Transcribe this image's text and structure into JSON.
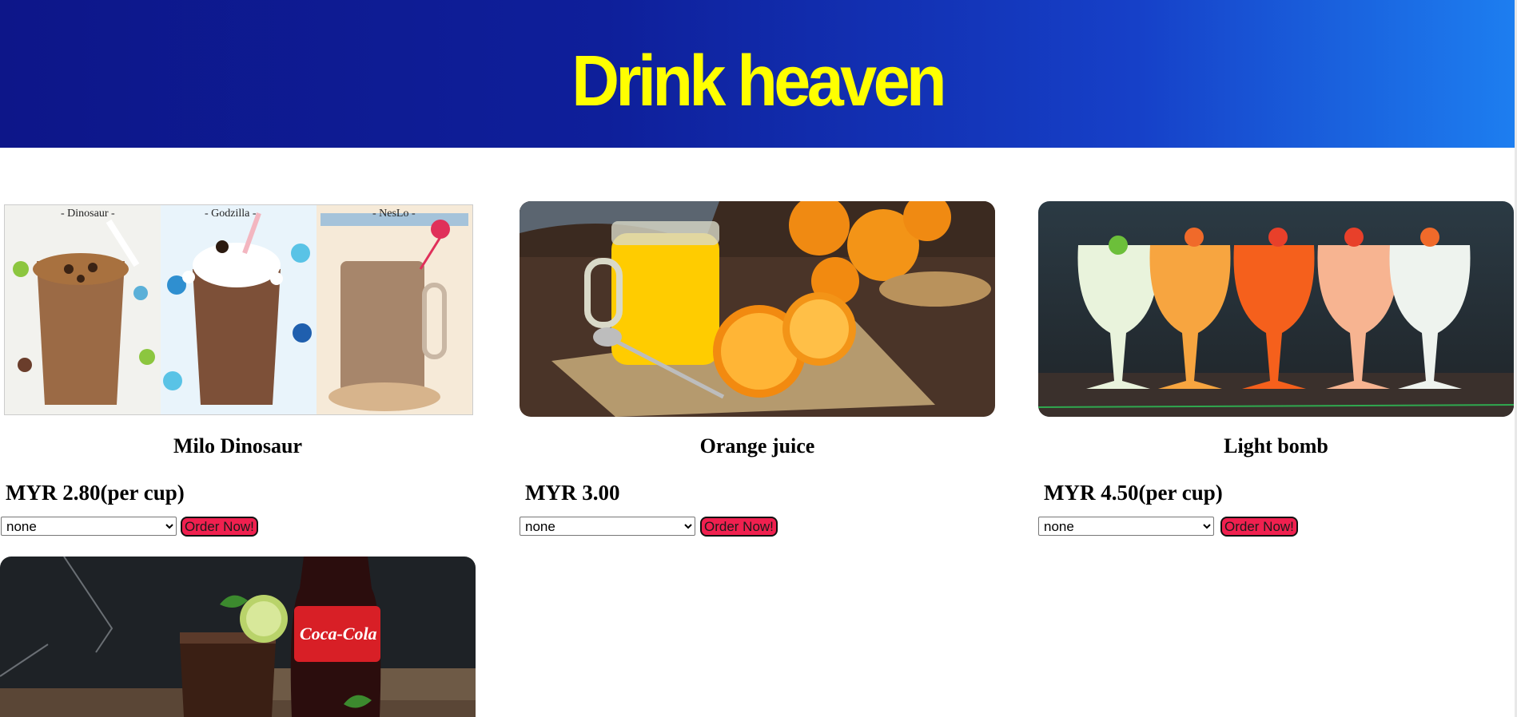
{
  "banner": {
    "title": "Drink heaven"
  },
  "products": [
    {
      "name": "Milo Dinosaur",
      "price": "MYR 2.80(per cup)",
      "select_value": "none",
      "order_label": "Order Now!",
      "image_captions": [
        "- Dinosaur -",
        "- Godzilla -",
        "- NesLo -"
      ]
    },
    {
      "name": "Orange juice",
      "price": "MYR 3.00",
      "select_value": "none",
      "order_label": "Order Now!"
    },
    {
      "name": "Light bomb",
      "price": "MYR 4.50(per cup)",
      "select_value": "none",
      "order_label": "Order Now!"
    },
    {
      "image_brand_text": "Coca-Cola"
    }
  ]
}
